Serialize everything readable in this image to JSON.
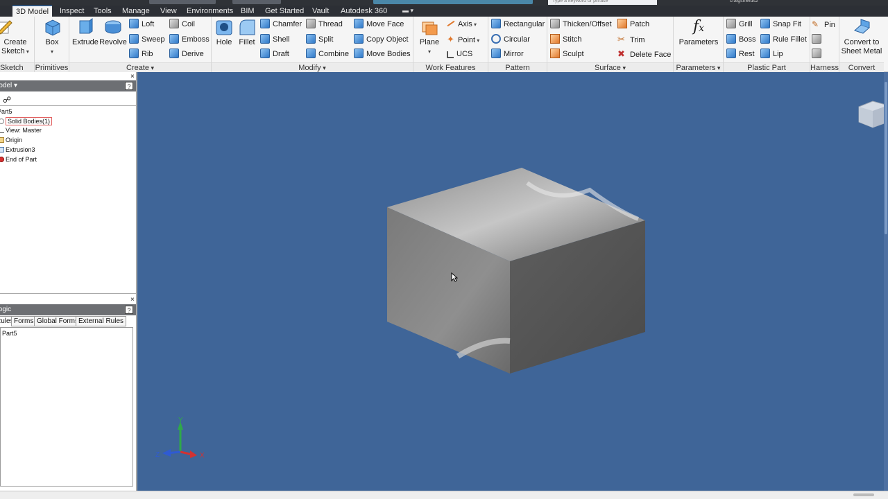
{
  "titlebar": {
    "search_placeholder": "Type a keyword or phrase",
    "user": "craigshields2"
  },
  "tabs": [
    {
      "label": "3D Model",
      "active": true
    },
    {
      "label": "Inspect"
    },
    {
      "label": "Tools"
    },
    {
      "label": "Manage"
    },
    {
      "label": "View"
    },
    {
      "label": "Environments"
    },
    {
      "label": "BIM"
    },
    {
      "label": "Get Started"
    },
    {
      "label": "Vault"
    },
    {
      "label": "Autodesk 360"
    }
  ],
  "ribbon": {
    "sketch": {
      "create": "Create",
      "sketch_word": "Sketch",
      "label": "Sketch"
    },
    "primitives": {
      "box": "Box",
      "label": "Primitives"
    },
    "create": {
      "extrude": "Extrude",
      "revolve": "Revolve",
      "loft": "Loft",
      "sweep": "Sweep",
      "rib": "Rib",
      "coil": "Coil",
      "emboss": "Emboss",
      "derive": "Derive",
      "label": "Create"
    },
    "modify": {
      "hole": "Hole",
      "fillet": "Fillet",
      "chamfer": "Chamfer",
      "shell": "Shell",
      "draft": "Draft",
      "thread": "Thread",
      "split": "Split",
      "combine": "Combine",
      "move_face": "Move Face",
      "copy_object": "Copy Object",
      "move_bodies": "Move Bodies",
      "label": "Modify"
    },
    "work_features": {
      "plane": "Plane",
      "axis": "Axis",
      "point": "Point",
      "ucs": "UCS",
      "label": "Work Features"
    },
    "pattern": {
      "rectangular": "Rectangular",
      "circular": "Circular",
      "mirror": "Mirror",
      "label": "Pattern"
    },
    "surface": {
      "thicken": "Thicken/Offset",
      "stitch": "Stitch",
      "sculpt": "Sculpt",
      "patch": "Patch",
      "trim": "Trim",
      "delete_face": "Delete Face",
      "label": "Surface"
    },
    "parameters": {
      "btn": "Parameters",
      "label": "Parameters"
    },
    "plastic": {
      "grill": "Grill",
      "boss": "Boss",
      "rest": "Rest",
      "snap_fit": "Snap Fit",
      "rule_fillet": "Rule Fillet",
      "lip": "Lip",
      "label": "Plastic Part"
    },
    "harness": {
      "pin": "Pin",
      "label": "Harness"
    },
    "convert": {
      "line1": "Convert to",
      "line2": "Sheet Metal",
      "label": "Convert"
    }
  },
  "browser": {
    "header": "Model",
    "tree": [
      {
        "label": "Part5"
      },
      {
        "label": "Solid Bodies(1)"
      },
      {
        "label": "View: Master"
      },
      {
        "label": "Origin"
      },
      {
        "label": "Extrusion3"
      },
      {
        "label": "End of Part"
      }
    ]
  },
  "ilogic": {
    "header": "iLogic",
    "tabs": [
      "Rules",
      "Forms",
      "Global Forms",
      "External Rules"
    ],
    "item": "Part5"
  },
  "triad": {
    "x": "X",
    "y": "Y",
    "z": "Z"
  },
  "colors": {
    "viewport": "#3f6598",
    "ribbon": "#f5f5f5",
    "tabbar": "#2c2f35",
    "accent": "#2f7ed8"
  }
}
